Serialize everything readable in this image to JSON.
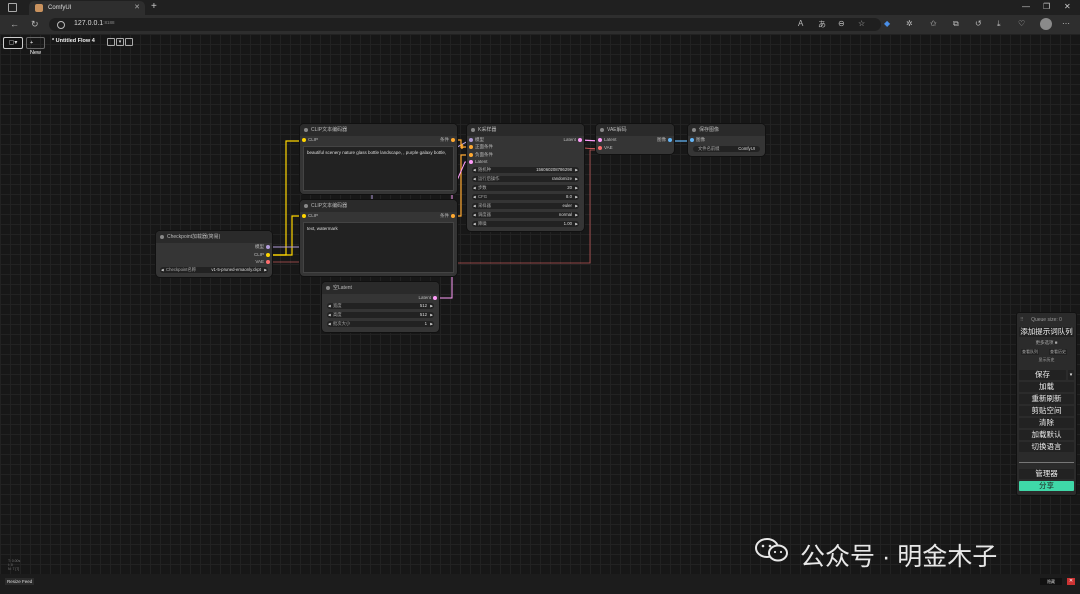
{
  "browser": {
    "tab_title": "ComfyUI",
    "tab_close": "✕",
    "new_tab": "+",
    "url_host": "127.0.0.1",
    "url_port": ":8188",
    "window_controls": [
      "—",
      "❐",
      "✕"
    ]
  },
  "toolbar": {
    "workflow_icon": "▢▾",
    "new_label": "+ New",
    "flow_title": "* Untitled Flow 4",
    "menu_down": "▾"
  },
  "nodes": {
    "clip_pos": {
      "title": "CLIP文本编码器",
      "in_label": "CLIP",
      "out_label": "条件",
      "text": "beautiful scenery nature glass bottle landscape, , purple galaxy bottle,"
    },
    "clip_neg": {
      "title": "CLIP文本编码器",
      "in_label": "CLIP",
      "out_label": "条件",
      "text": "text, watermark"
    },
    "checkpoint": {
      "title": "Checkpoint加载器(简易)",
      "outputs": [
        "模型",
        "CLIP",
        "VAE"
      ],
      "widget_label": "Checkpoint名称",
      "widget_value": "v1-5-pruned-emaonly.ckpt"
    },
    "ksampler": {
      "title": "K采样器",
      "inputs": [
        "模型",
        "正面条件",
        "负面条件",
        "Latent"
      ],
      "out_label": "Latent",
      "widgets": [
        {
          "label": "随机种",
          "value": "156060208786298"
        },
        {
          "label": "运行后操作",
          "value": "randomize"
        },
        {
          "label": "步数",
          "value": "20"
        },
        {
          "label": "CFG",
          "value": "8.0"
        },
        {
          "label": "采样器",
          "value": "euler"
        },
        {
          "label": "调度器",
          "value": "normal"
        },
        {
          "label": "降噪",
          "value": "1.00"
        }
      ]
    },
    "vae_decode": {
      "title": "VAE解码",
      "inputs": [
        "Latent",
        "VAE"
      ],
      "out_label": "图像"
    },
    "save_image": {
      "title": "保存图像",
      "in_label": "图像",
      "widget_label": "文件名前缀",
      "widget_value": "ComfyUI"
    },
    "empty_latent": {
      "title": "空Latent",
      "out_label": "Latent",
      "widgets": [
        {
          "label": "宽度",
          "value": "512"
        },
        {
          "label": "高度",
          "value": "512"
        },
        {
          "label": "批次大小",
          "value": "1"
        }
      ]
    }
  },
  "queue": {
    "size_label": "Queue size: 0",
    "add_prompt": "添加提示词队列",
    "extra_options": "更多选项",
    "view_queue": "查看队列",
    "view_history": "查看历史",
    "view_history_short": "显示历史",
    "buttons": [
      "保存",
      "加载",
      "重新刷新",
      "剪贴空间",
      "清除",
      "加载默认",
      "切换语言"
    ],
    "manager": "管理器",
    "share": "分享"
  },
  "bottom": {
    "resize_feed": "Resize Feed",
    "info_lines": [
      "T: 0.00s",
      "I: 0",
      "N: 7 [7]"
    ],
    "right_btn": "隐藏",
    "close": "✕"
  },
  "watermark": "公众号 · 明金木子",
  "colors": {
    "model": "#b39ddb",
    "clip": "#ffd500",
    "vae": "#ff6e6e",
    "conditioning": "#ffa931",
    "latent": "#ff9cf9",
    "image": "#64b5f6",
    "share": "#3fd8a8"
  }
}
